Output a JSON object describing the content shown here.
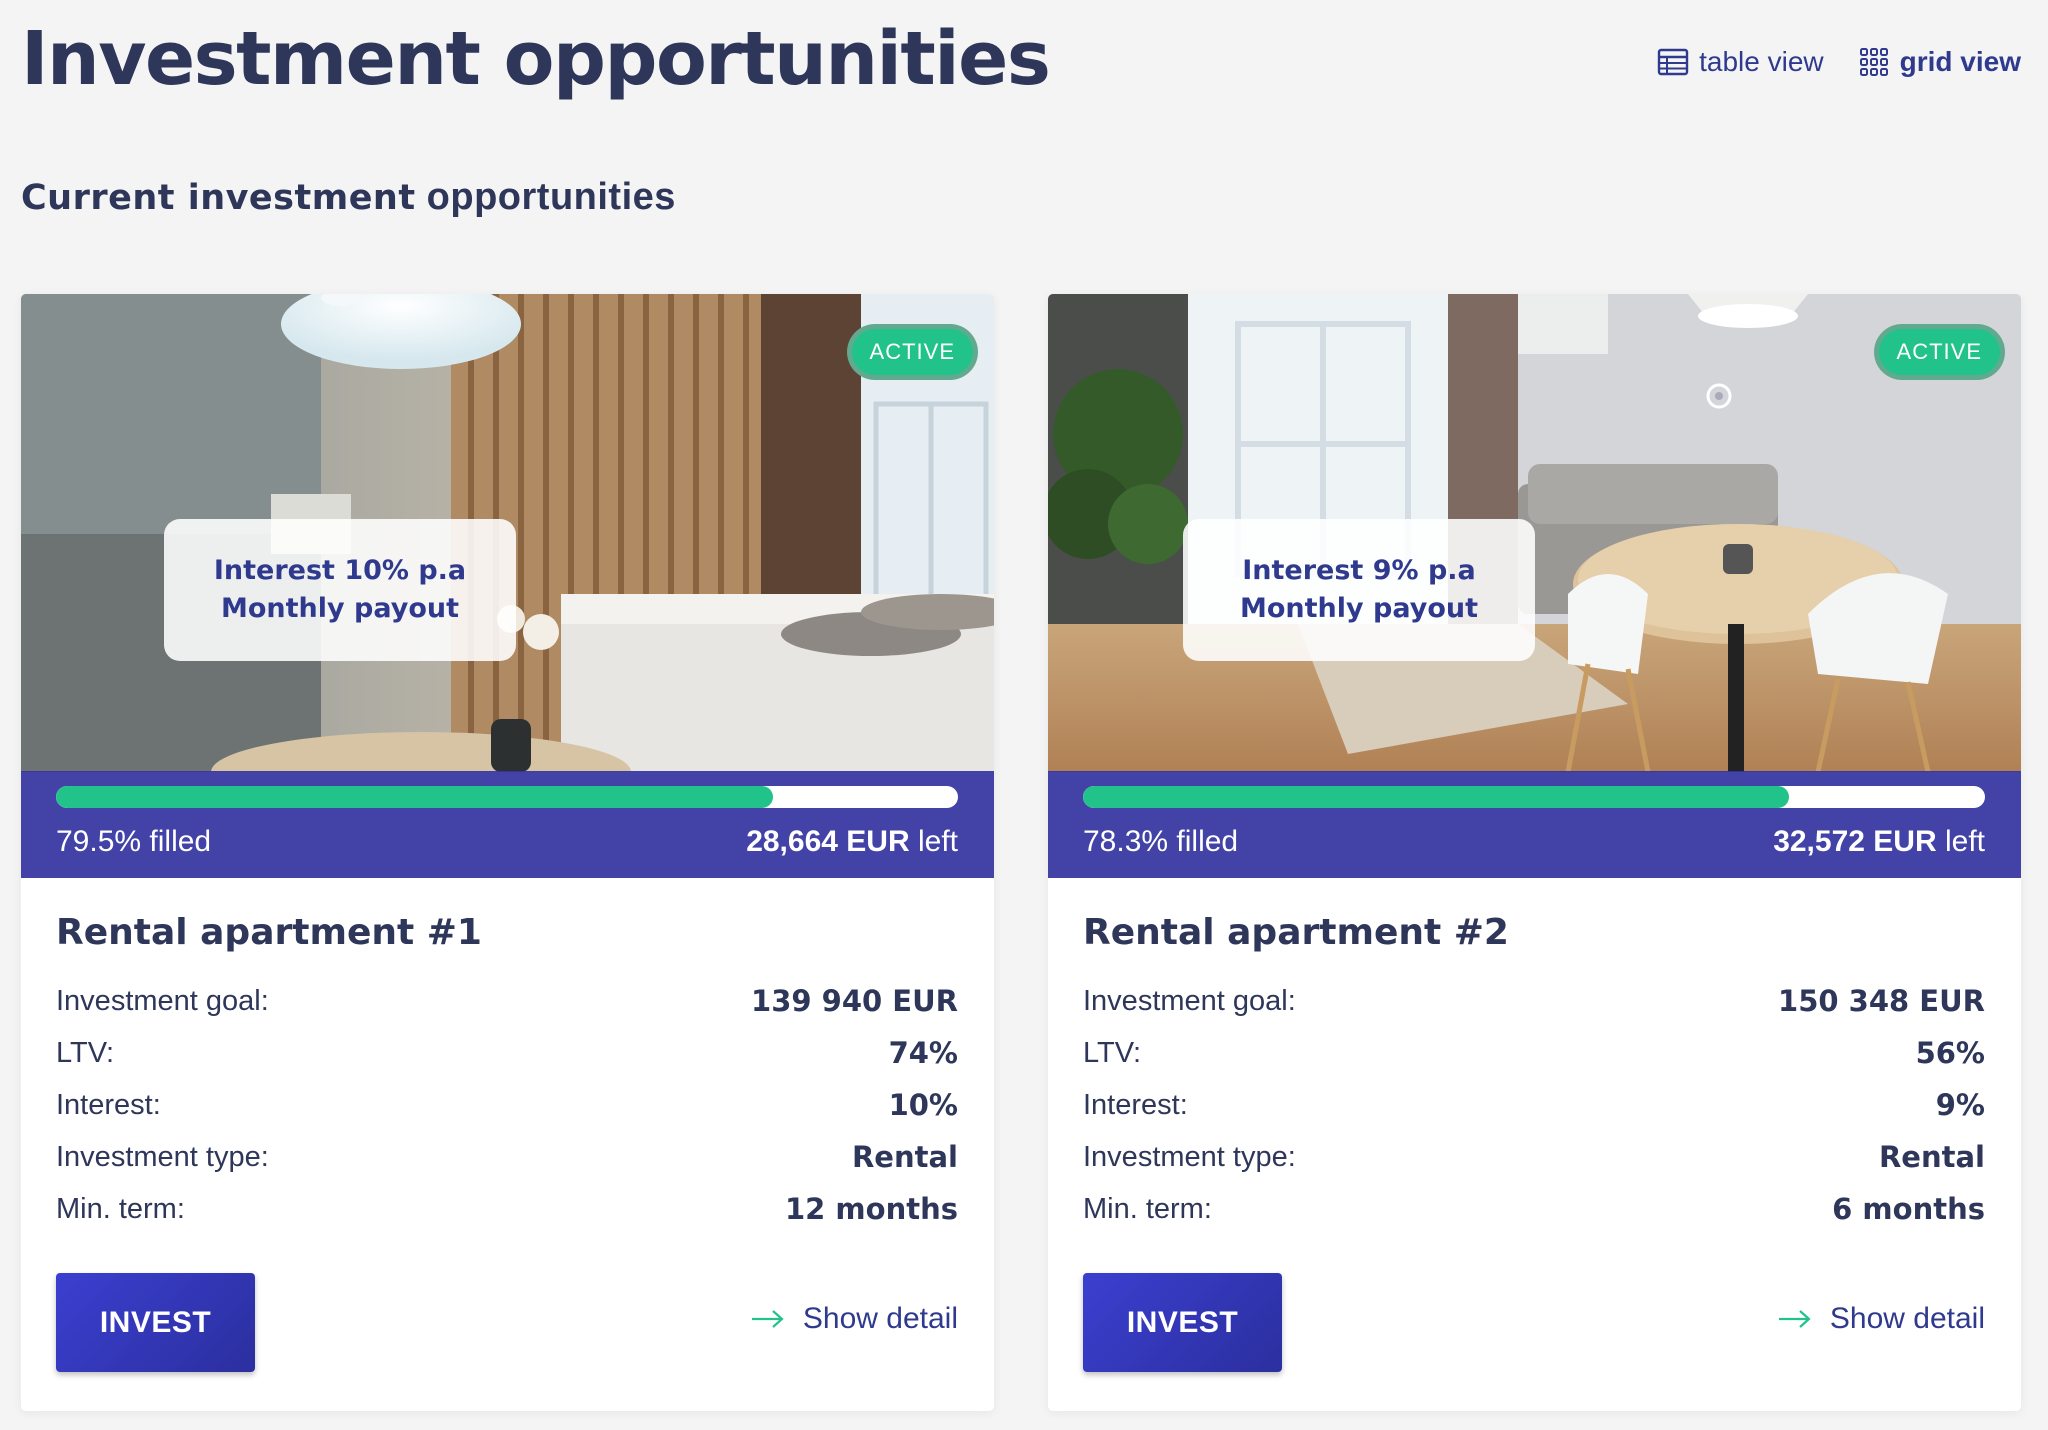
{
  "header": {
    "title": "Investment opportunities",
    "table_view_label": "table view",
    "grid_view_label": "grid view",
    "active_view": "grid"
  },
  "section": {
    "title_bold": "Current investment",
    "title_rest": "opportunities"
  },
  "colors": {
    "primary": "#2f3a8f",
    "accent_green": "#22c38a",
    "text_dark": "#2e3659",
    "fill_panel": "#3434a0"
  },
  "cards": [
    {
      "status": "ACTIVE",
      "promo_line1": "Interest 10% p.a",
      "promo_line2": "Monthly payout",
      "filled_percent": 79.5,
      "filled_label": "79.5% filled",
      "left_amount": "28,664 EUR",
      "left_suffix": "left",
      "title": "Rental apartment #1",
      "details": [
        {
          "label": "Investment goal:",
          "value": "139 940 EUR"
        },
        {
          "label": "LTV:",
          "value": "74%"
        },
        {
          "label": "Interest:",
          "value": "10%"
        },
        {
          "label": "Investment type:",
          "value": "Rental"
        },
        {
          "label": "Min. term:",
          "value": "12 months"
        }
      ],
      "invest_label": "INVEST",
      "detail_label": "Show detail"
    },
    {
      "status": "ACTIVE",
      "promo_line1": "Interest 9% p.a",
      "promo_line2": "Monthly payout",
      "filled_percent": 78.3,
      "filled_label": "78.3% filled",
      "left_amount": "32,572 EUR",
      "left_suffix": "left",
      "title": "Rental apartment #2",
      "details": [
        {
          "label": "Investment goal:",
          "value": "150 348 EUR"
        },
        {
          "label": "LTV:",
          "value": "56%"
        },
        {
          "label": "Interest:",
          "value": "9%"
        },
        {
          "label": "Investment type:",
          "value": "Rental"
        },
        {
          "label": "Min. term:",
          "value": "6 months"
        }
      ],
      "invest_label": "INVEST",
      "detail_label": "Show detail"
    }
  ]
}
